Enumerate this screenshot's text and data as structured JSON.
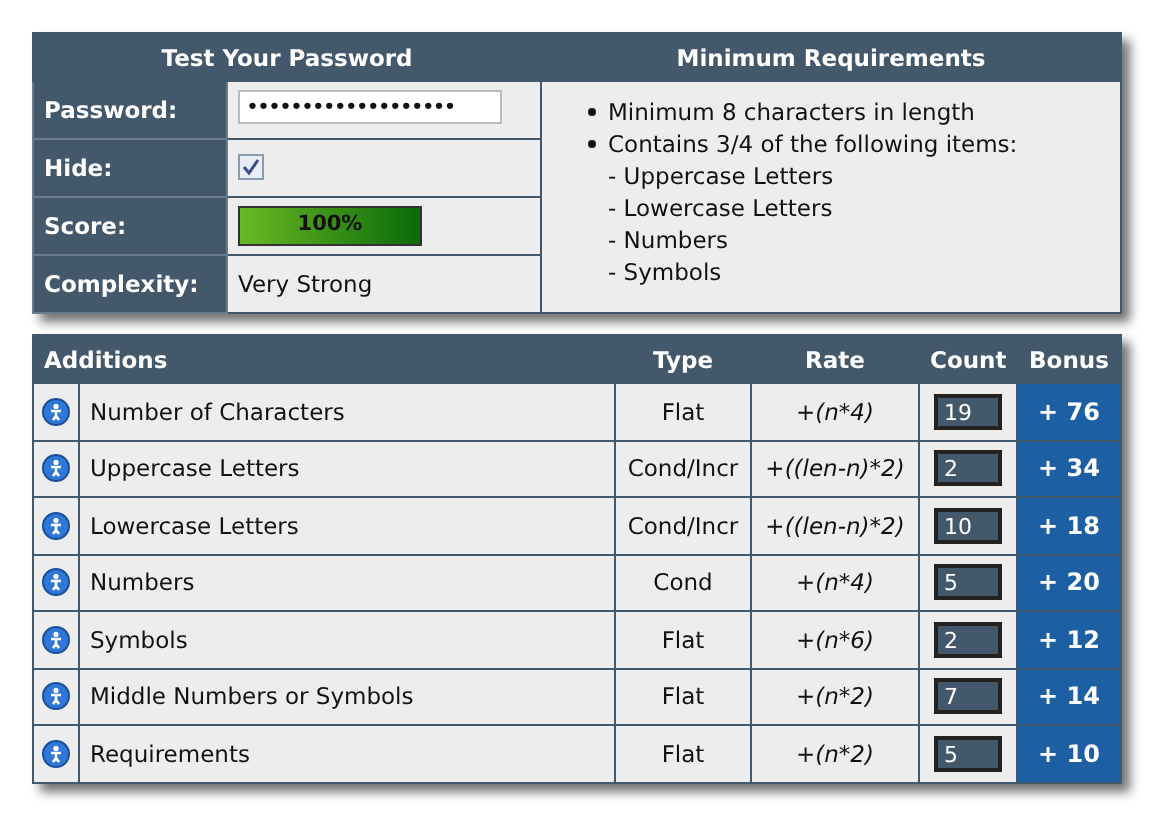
{
  "test": {
    "title": "Test Your Password",
    "password_label": "Password:",
    "password_value": "•••••••••••••••••••",
    "hide_label": "Hide:",
    "hide_checked": true,
    "score_label": "Score:",
    "score": {
      "level": 1.0,
      "reading": "100%"
    },
    "complexity_label": "Complexity:",
    "complexity": "Very Strong"
  },
  "requirements": {
    "title": "Minimum Requirements",
    "items": [
      {
        "text": "Minimum 8 characters in length"
      },
      {
        "text": "Contains 3/4 of the following items:",
        "children": [
          "- Uppercase Letters",
          "- Lowercase Letters",
          "- Numbers",
          "- Symbols"
        ]
      }
    ]
  },
  "additions": {
    "columns": [
      "Additions",
      "Type",
      "Rate",
      "Count",
      "Bonus"
    ],
    "rows": [
      {
        "name": "Number of Characters",
        "type": "Flat",
        "rate_sign": "+",
        "rate": "(n*4)",
        "count": "19",
        "bonus": "+ 76"
      },
      {
        "name": "Uppercase Letters",
        "type": "Cond/Incr",
        "rate_sign": "+",
        "rate": "((len-n)*2)",
        "count": "2",
        "bonus": "+ 34"
      },
      {
        "name": "Lowercase Letters",
        "type": "Cond/Incr",
        "rate_sign": "+",
        "rate": "((len-n)*2)",
        "count": "10",
        "bonus": "+ 18"
      },
      {
        "name": "Numbers",
        "type": "Cond",
        "rate_sign": "+",
        "rate": "(n*4)",
        "count": "5",
        "bonus": "+ 20"
      },
      {
        "name": "Symbols",
        "type": "Flat",
        "rate_sign": "+",
        "rate": "(n*6)",
        "count": "2",
        "bonus": "+ 12"
      },
      {
        "name": "Middle Numbers or Symbols",
        "type": "Flat",
        "rate_sign": "+",
        "rate": "(n*2)",
        "count": "7",
        "bonus": "+ 14"
      },
      {
        "name": "Requirements",
        "type": "Flat",
        "rate_sign": "+",
        "rate": "(n*2)",
        "count": "5",
        "bonus": "+ 10"
      }
    ]
  }
}
